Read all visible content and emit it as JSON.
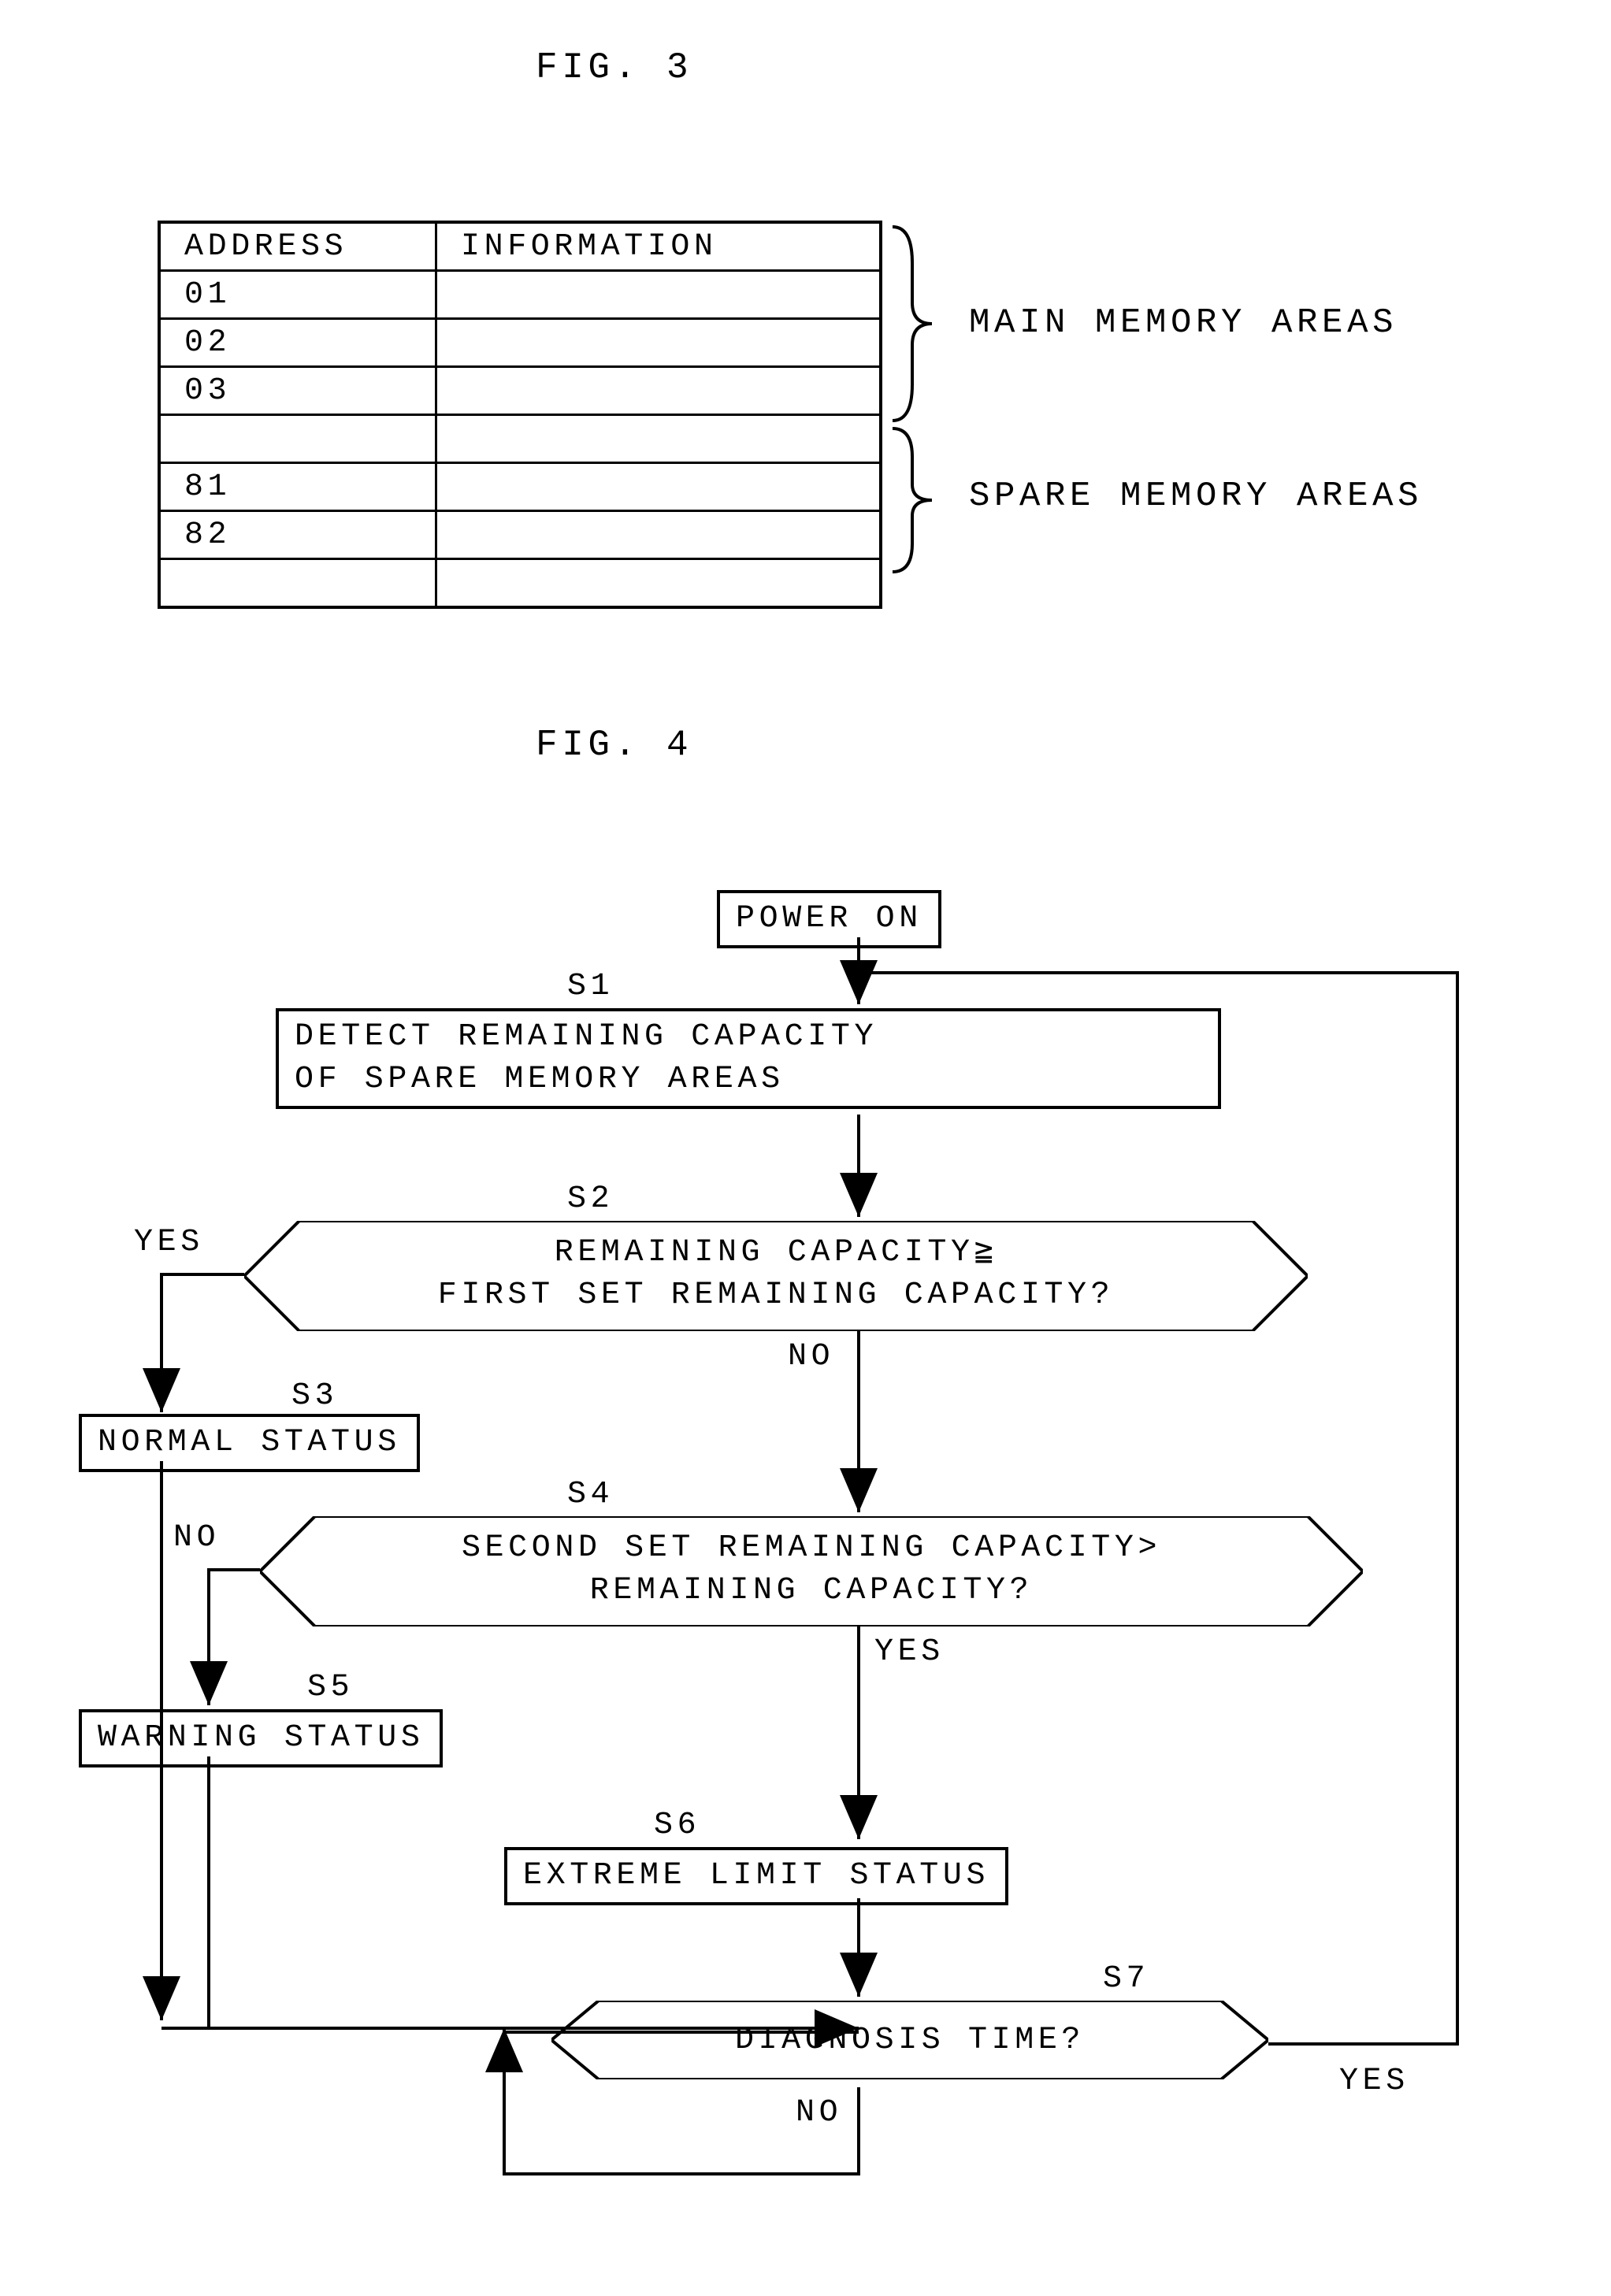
{
  "fig3": {
    "title": "FIG. 3",
    "header_address": "ADDRESS",
    "header_info": "INFORMATION",
    "rows": [
      "01",
      "02",
      "03",
      "",
      "81",
      "82",
      ""
    ],
    "main_label": "MAIN MEMORY AREAS",
    "spare_label": "SPARE MEMORY AREAS"
  },
  "fig4": {
    "title": "FIG. 4",
    "power_on": "POWER ON",
    "s1_label": "S1",
    "s1_text": "DETECT REMAINING CAPACITY\nOF SPARE MEMORY AREAS",
    "s2_label": "S2",
    "s2_text": "REMAINING CAPACITY≧\nFIRST SET REMAINING CAPACITY?",
    "s2_yes": "YES",
    "s2_no": "NO",
    "s3_label": "S3",
    "s3_text": "NORMAL STATUS",
    "s4_label": "S4",
    "s4_text": "SECOND SET REMAINING CAPACITY>\nREMAINING CAPACITY?",
    "s4_no": "NO",
    "s4_yes": "YES",
    "s5_label": "S5",
    "s5_text": "WARNING STATUS",
    "s6_label": "S6",
    "s6_text": "EXTREME LIMIT STATUS",
    "s7_label": "S7",
    "s7_text": "DIAGNOSIS TIME?",
    "s7_yes": "YES",
    "s7_no": "NO"
  }
}
